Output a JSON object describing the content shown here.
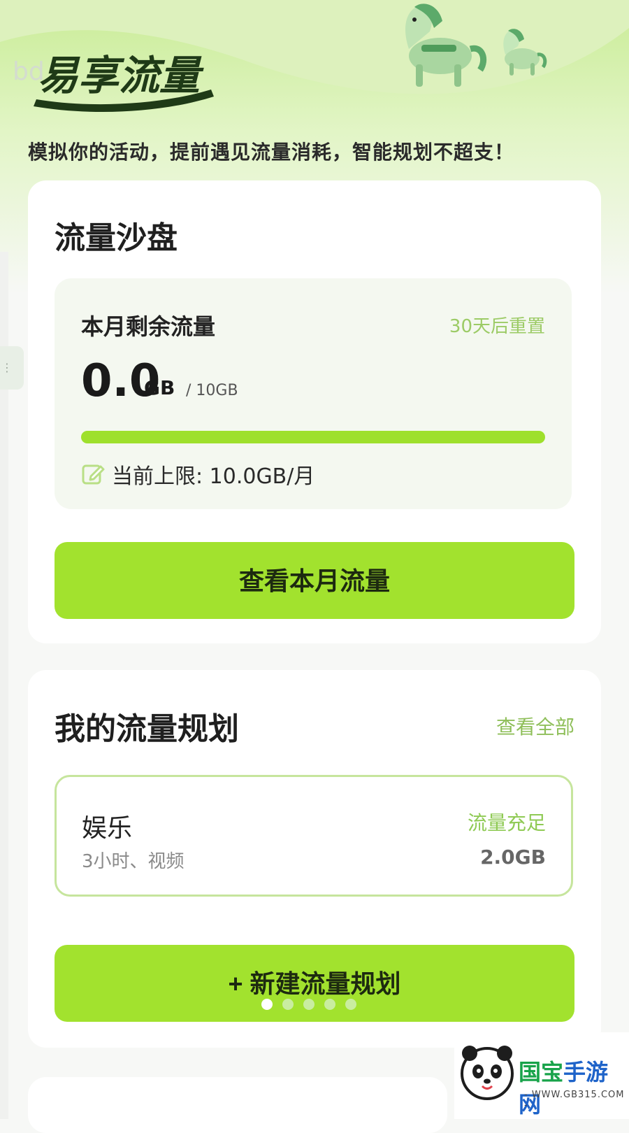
{
  "header": {
    "ghost_text": "bd",
    "logo_text": "易享流量",
    "slogan": "模拟你的活动，提前遇见流量消耗，智能规划不超支！",
    "side_handle": "⋮"
  },
  "sandbox": {
    "title": "流量沙盘",
    "remaining_label": "本月剩余流量",
    "reset_text": "30天后重置",
    "remaining_value": "0.0",
    "remaining_unit": "GB",
    "total_text": "/ 10GB",
    "usage_fraction": 1.0,
    "limit_text": "当前上限: 10.0GB/月",
    "view_button": "查看本月流量"
  },
  "plans": {
    "title": "我的流量规划",
    "view_all": "查看全部",
    "items": [
      {
        "name": "娱乐",
        "desc": "3小时、视频",
        "status": "流量充足",
        "size": "2.0GB"
      }
    ],
    "new_button": "+ 新建流量规划"
  },
  "pager": {
    "count": 5,
    "active": 0
  },
  "watermark": {
    "title_part1": "国宝",
    "title_part2": "手游网",
    "url": "- WWW.GB315.COM -"
  },
  "colors": {
    "accent": "#a2e22e",
    "accent_text": "#8fca54",
    "bg": "#f7f8f6"
  }
}
